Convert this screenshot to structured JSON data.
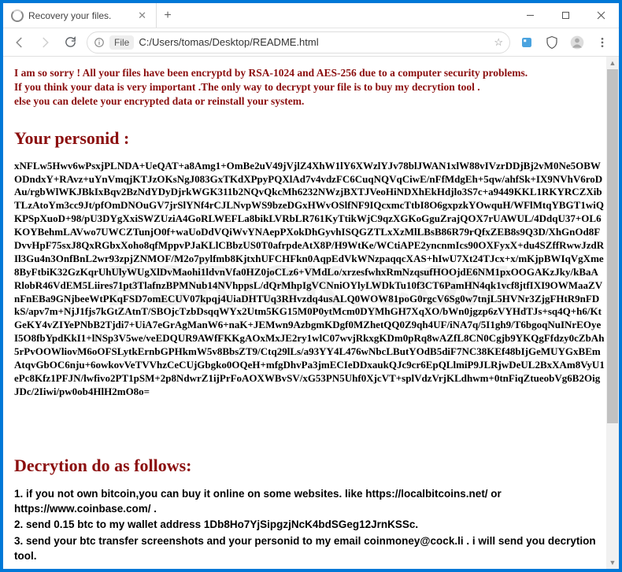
{
  "tab": {
    "title": "Recovery your files."
  },
  "win": {
    "min": "—",
    "max": "▢",
    "close": "✕"
  },
  "addr": {
    "file_label": "File",
    "url": "C:/Users/tomas/Desktop/README.html"
  },
  "page": {
    "intro_line1": "I am so sorry ! All your files have been encryptd by RSA-1024 and AES-256 due to a computer security problems.",
    "intro_line2": "If you think your data is very important .The only way to decrypt your file is to buy my decrytion tool .",
    "intro_line3": "else you can delete your encrypted data or reinstall your system.",
    "personid_heading": "Your personid :",
    "personid": "xNFLw5Hwv6wPsxjPLNDA+UeQAT+a8Amg1+OmBe2uV49jVjlZ4XhW1lY6XWzlYJv78blJWAN1xlW88vIVzrDDjBj2vM0Ne5OBWODndxY+RAvz+uYnVmqjKTJzOKsNgJ083GxTKdXPpyPQXlAd7v4vdzFC6CuqNQVqCiwE/nFfMdgEh+5qw/ahfSk+IX9NVhV6roDAu/rgbWlWKJBkIxBqv2BzNdYDyDjrkWGK311b2NQvQkcMh6232NWzjBXTJVeoHiNDXhEkHdjlo3S7c+a9449KKL1RKYRCZXibTLzAtoYm3cc9Jt/pfOmDNOuGV7jrSlYNf4rCJLNvpWS9bzeDGxHWvOSlfNF9IQcxmcTtbI8O6gxpzkYOwquH/WFlMtqYBGT1wiQKPSpXuoD+98/pU3DYgXxiSWZUziA4GoRLWEFLa8bikLVRbLR761KyTtikWjC9qzXGKoGguZrajQOX7rUAWUL/4DdqU37+OL6KOYBehmLAVwo7UWCZTunjO0f+waUoDdVQiWvYNAepPXokDhGyvhISQGZTLxXzMlLBsB86R79rQfxZEB8s9Q3D/XhGnOd8FDvvHpF75sxJ8QxRGbxXoho8qfMppvPJaKLlCBbzUS0T0afrpdeAtX8P/H9WtKe/WCtiAPE2yncnmIcs90OXFyxX+du4SZffRwwJzdRIl3Gu4n3OnfBnL2wr93zpjZNMOF/M2o7pylfmb8KjtxhUFCHFkn0AqpEdVkWNzpaqqcXAS+hIwU7Xt24TJcx+x/mKjpBWIqVgXme8ByFtbiK32GzKqrUhUlyWUgXlDvMaohi1ldvnVfa0HZ0joCLz6+VMdLo/xrzesfwhxRmNzqsufHOOjdE6NM1pxOOGAKzJky/kBaARlobR46VdEM5Liires71pt3TlafnzBPMNub14NVhppsL/dQrMhpIgVCNniOYlyLWDkTu10f3CT6PamHN4qk1vcf8jtfIXI9OWMaaZVnFnEBa9GNjbeeWtPKqFSD7omECUV07kpqj4UiaDHTUq3RHvzdq4usALQ0WOW81poG0rgcV6Sg0w7tnjL5HVNr3ZjgFHtR9nFDkS/apv7m+NjJ1fjs7kGtZAtnT/SBOjcTzbDsqqWYx2Utm5KG15M0P0ytMcm0DYMhGH7XqXO/bWn0jgzp6zVYHdTJs+sq4Q+h6/KtGeKY4vZIYePNbB2Tjdi7+UiA7eGrAgManW6+naK+JEMwn9AzbgmKDgf0MZhetQQ0Z9qh4UF/iNA7q/5I1gh9/T6bgoqNuINrEOyeI5O8fbYpdKkI1+lNSp3V5we/veEDQUR9AWfFKKgAOxMxJE2ry1wlC07wvjRkxgKDm0pRq8wAZfL8CN0Cgjb9YKQgFfdzy0cZbAh5rPvOOWliovM6oOFSLytkErnbGPHkmW5v8BbsZT9/Ctq29lLs/a93YY4L476wNbcLButYOdB5diF7NC38KEf48bIjGeMUYGxBEmAtqvGbOC6nju+6owkovVeTVVhzCeCUjGbgko0OQeH+mfgDhvPa3jmECIeDDxaukQJc9cr6EpQLlmiP9JLRjwDeUL2BxXAm8VyU1ePc8Kfz1PFJN/lwfivo2PT1pSM+2p8NdwrZ1ijPrFoAOXWBvSV/xG53PN5Uhf0XjcVT+splVdzVrjKLdhwm+0tnFiqZtueobVg6B2OigJDc/2Iiwi/pw0ob4HlH2mO8o=",
    "decrytion_heading": "Decrytion do as follows:",
    "step1": "1. if you not own bitcoin,you can buy it online on some websites. like https://localbitcoins.net/ or https://www.coinbase.com/ .",
    "step2": "2. send 0.15 btc to my wallet address 1Db8Ho7YjSipgzjNcK4bdSGeg12JrnKSSc.",
    "step3": "3. send your btc transfer screenshots and your personid to my email coinmoney@cock.li . i will send you decrytion tool."
  },
  "watermark": "PCRISK.COM"
}
